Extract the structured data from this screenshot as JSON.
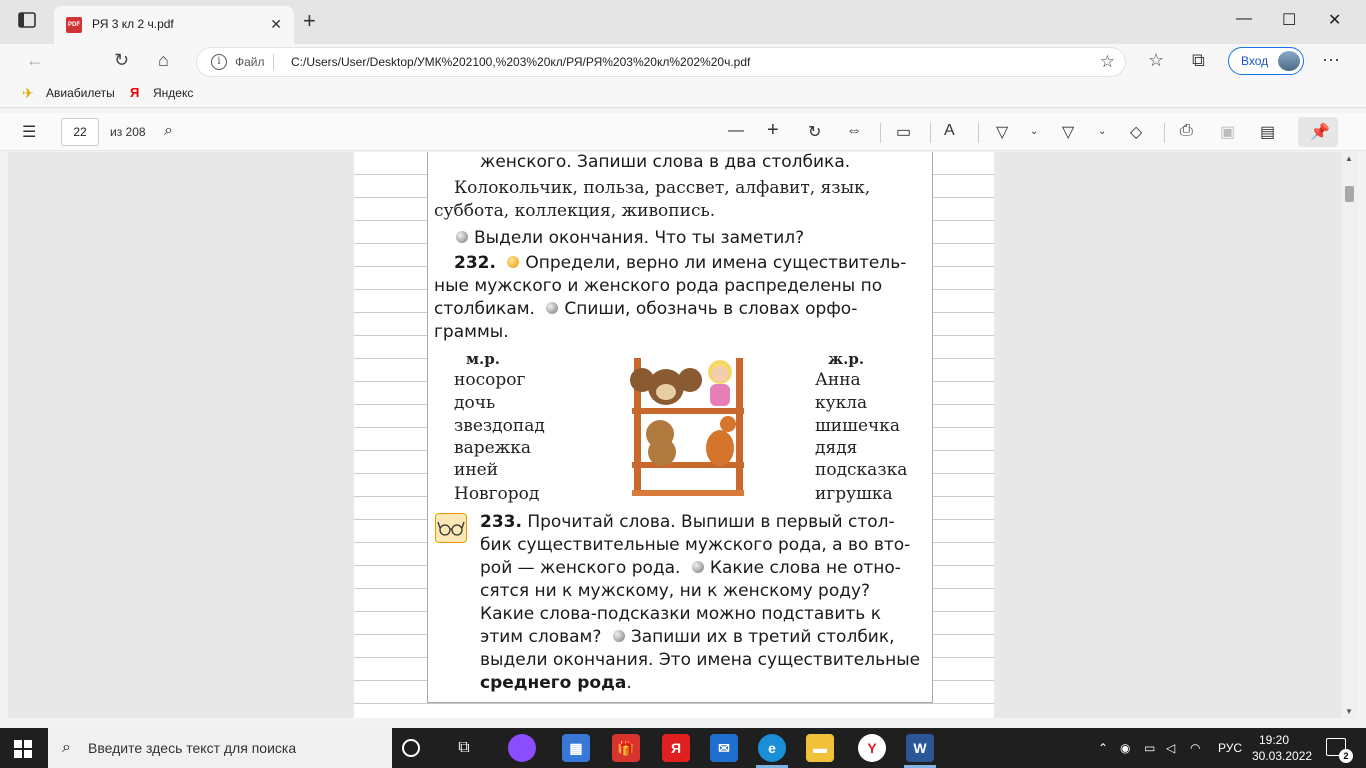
{
  "browser": {
    "tab_title": "РЯ 3 кл 2 ч.pdf",
    "tab_close": "✕",
    "new_tab": "+",
    "window": {
      "minimize": "—",
      "maximize": "☐",
      "close": "✕"
    },
    "address": {
      "protocol_label": "Файл",
      "url": "C:/Users/User/Desktop/УМК%202100,%203%20кл/РЯ/РЯ%203%20кл%202%20ч.pdf"
    },
    "login_label": "Вход",
    "bookmarks": [
      {
        "label": "Авиабилеты",
        "icon": "airplane-icon"
      },
      {
        "label": "Яндекс",
        "icon": "yandex-icon"
      }
    ]
  },
  "pdf_toolbar": {
    "page_current": "22",
    "page_total": "из 208"
  },
  "page": {
    "line1": "женского. Запиши слова в два столбика.",
    "words_line1": "Колокольчик, польза, рассвет, алфавит, язык,",
    "words_line2": "суббота, коллекция, живопись.",
    "task_mark": "Выдели окончания. Что ты заметил?",
    "ex232_num": "232.",
    "ex232_l1": "Определи, верно ли имена существитель-",
    "ex232_l2": "ные мужского и женского рода распределены по",
    "ex232_l3a": "столбикам.",
    "ex232_l3b": "Спиши, обозначь в словах орфо-",
    "ex232_l4": "граммы.",
    "col_m_head": "м.р.",
    "col_m": [
      "носорог",
      "дочь",
      "звездопад",
      "варежка",
      "иней",
      "Новгород"
    ],
    "col_f_head": "ж.р.",
    "col_f": [
      "Анна",
      "кукла",
      "шишечка",
      "дядя",
      "подсказка",
      "игрушка"
    ],
    "ex233_num": "233.",
    "ex233_l1": "Прочитай слова. Выпиши в первый стол-",
    "ex233_l2": "бик существительные мужского рода, а во вто-",
    "ex233_l3a": "рой — женского рода.",
    "ex233_l3b": "Какие слова не отно-",
    "ex233_l4": "сятся ни к мужскому, ни к женскому роду?",
    "ex233_l5": "Какие слова-подсказки можно подставить к",
    "ex233_l6a": "этим словам?",
    "ex233_l6b": "Запиши их в третий столбик,",
    "ex233_l7": "выдели окончания. Это имена существительные",
    "ex233_l8": "среднего рода",
    "ex233_l8_end": "."
  },
  "taskbar": {
    "search_placeholder": "Введите здесь текст для поиска",
    "language": "РУС",
    "time": "19:20",
    "date": "30.03.2022",
    "notifications": "2"
  },
  "colors": {
    "accent_orange": "#e39b00",
    "taskbar_bg": "#1f1f1f",
    "edge_blue": "#1a73e8"
  }
}
